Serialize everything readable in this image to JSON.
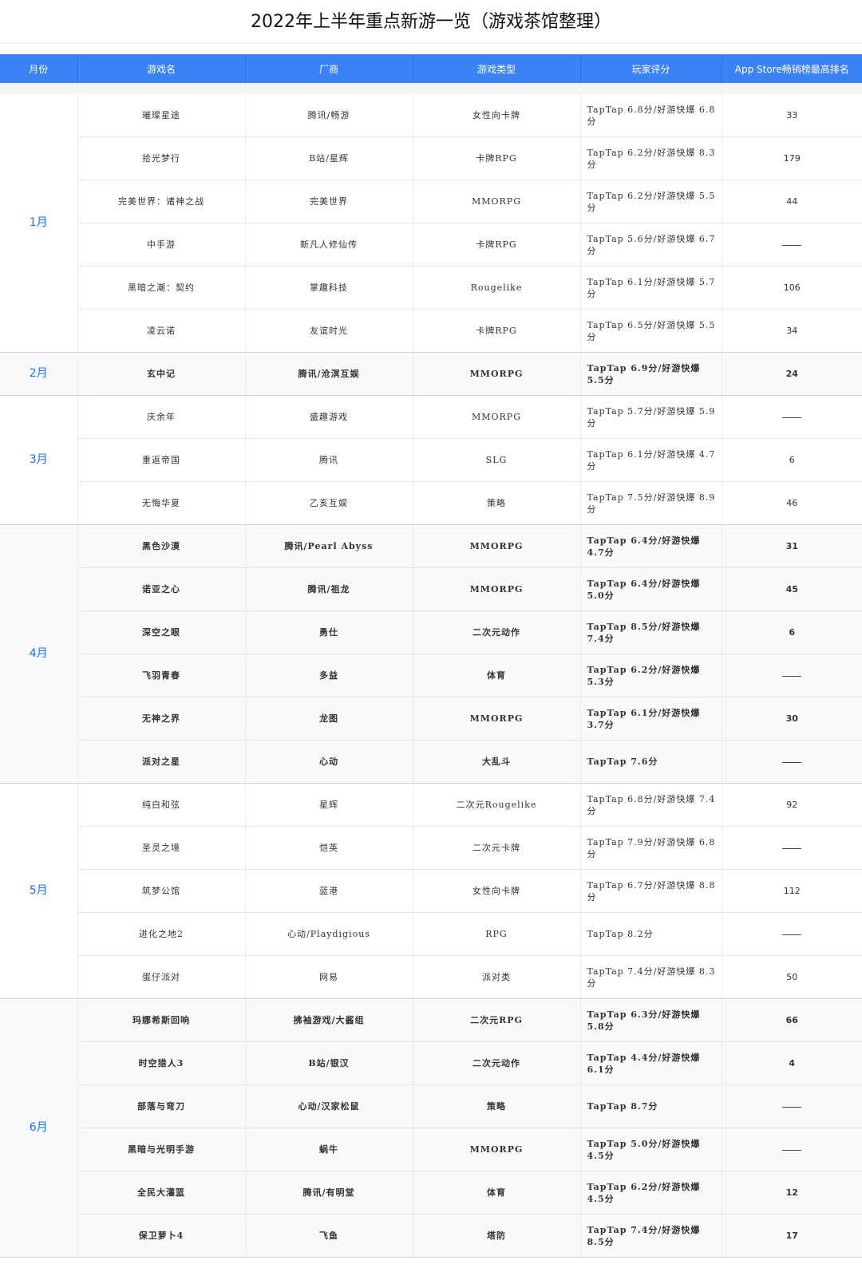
{
  "title": "2022年上半年重点新游一览（游戏茶馆整理）",
  "headers": [
    "月份",
    "游戏名",
    "厂商",
    "游戏类型",
    "玩家评分",
    "App Store畅销榜最高排名"
  ],
  "dash": "——",
  "groups": [
    {
      "month": "1月",
      "bold": false,
      "alt": false,
      "rows": [
        {
          "name": "璀璨星途",
          "vendor": "腾讯/畅游",
          "genre": "女性向卡牌",
          "score": "TapTap 6.8分/好游快爆 6.8分",
          "rank": "33"
        },
        {
          "name": "拾光梦行",
          "vendor": "B站/星辉",
          "genre": "卡牌RPG",
          "score": "TapTap 6.2分/好游快爆 8.3分",
          "rank": "179"
        },
        {
          "name": "完美世界：诸神之战",
          "vendor": "完美世界",
          "genre": "MMORPG",
          "score": "TapTap 6.2分/好游快爆 5.5分",
          "rank": "44"
        },
        {
          "name": "中手游",
          "vendor": "新凡人修仙传",
          "genre": "卡牌RPG",
          "score": "TapTap 5.6分/好游快爆 6.7分",
          "rank": ""
        },
        {
          "name": "黑暗之潮：契约",
          "vendor": "掌趣科技",
          "genre": "Rougelike",
          "score": "TapTap 6.1分/好游快爆 5.7分",
          "rank": "106"
        },
        {
          "name": "凌云诺",
          "vendor": "友谊时光",
          "genre": "卡牌RPG",
          "score": "TapTap 6.5分/好游快爆 5.5分",
          "rank": "34"
        }
      ]
    },
    {
      "month": "2月",
      "bold": true,
      "alt": true,
      "rows": [
        {
          "name": "玄中记",
          "vendor": "腾讯/沧溟互娱",
          "genre": "MMORPG",
          "score": "TapTap 6.9分/好游快爆 5.5分",
          "rank": "24"
        }
      ]
    },
    {
      "month": "3月",
      "bold": false,
      "alt": false,
      "rows": [
        {
          "name": "庆余年",
          "vendor": "盛趣游戏",
          "genre": "MMORPG",
          "score": "TapTap 5.7分/好游快爆 5.9分",
          "rank": ""
        },
        {
          "name": "重返帝国",
          "vendor": "腾讯",
          "genre": "SLG",
          "score": "TapTap 6.1分/好游快爆 4.7分",
          "rank": "6"
        },
        {
          "name": "无悔华夏",
          "vendor": "乙亥互娱",
          "genre": "策略",
          "score": "TapTap 7.5分/好游快爆 8.9分",
          "rank": "46"
        }
      ]
    },
    {
      "month": "4月",
      "bold": true,
      "alt": true,
      "rows": [
        {
          "name": "黑色沙漠",
          "vendor": "腾讯/Pearl Abyss",
          "genre": "MMORPG",
          "score": "TapTap 6.4分/好游快爆 4.7分",
          "rank": "31"
        },
        {
          "name": "诺亚之心",
          "vendor": "腾讯/祖龙",
          "genre": "MMORPG",
          "score": "TapTap 6.4分/好游快爆 5.0分",
          "rank": "45"
        },
        {
          "name": "深空之眼",
          "vendor": "勇仕",
          "genre": "二次元动作",
          "score": "TapTap 8.5分/好游快爆 7.4分",
          "rank": "6"
        },
        {
          "name": "飞羽青春",
          "vendor": "多益",
          "genre": "体育",
          "score": "TapTap 6.2分/好游快爆 5.3分",
          "rank": ""
        },
        {
          "name": "无神之界",
          "vendor": "龙图",
          "genre": "MMORPG",
          "score": "TapTap 6.1分/好游快爆 3.7分",
          "rank": "30"
        },
        {
          "name": "派对之星",
          "vendor": "心动",
          "genre": "大乱斗",
          "score": "TapTap 7.6分",
          "rank": ""
        }
      ]
    },
    {
      "month": "5月",
      "bold": false,
      "alt": false,
      "rows": [
        {
          "name": "纯白和弦",
          "vendor": "星辉",
          "genre": "二次元Rougelike",
          "score": "TapTap 6.8分/好游快爆 7.4分",
          "rank": "92"
        },
        {
          "name": "圣灵之境",
          "vendor": "恺英",
          "genre": "二次元卡牌",
          "score": "TapTap 7.9分/好游快爆 6.8分",
          "rank": ""
        },
        {
          "name": "筑梦公馆",
          "vendor": "蓝港",
          "genre": "女性向卡牌",
          "score": "TapTap 6.7分/好游快爆 8.8分",
          "rank": "112"
        },
        {
          "name": "进化之地2",
          "vendor": "心动/Playdigious",
          "genre": "RPG",
          "score": "TapTap 8.2分",
          "rank": ""
        },
        {
          "name": "蛋仔派对",
          "vendor": "网易",
          "genre": "派对类",
          "score": "TapTap 7.4分/好游快爆 8.3分",
          "rank": "50"
        }
      ]
    },
    {
      "month": "6月",
      "bold": true,
      "alt": true,
      "rows": [
        {
          "name": "玛娜希斯回响",
          "vendor": "拂袖游戏/大酱组",
          "genre": "二次元RPG",
          "score": "TapTap 6.3分/好游快爆 5.8分",
          "rank": "66"
        },
        {
          "name": "时空猎人3",
          "vendor": "B站/银汉",
          "genre": "二次元动作",
          "score": "TapTap 4.4分/好游快爆 6.1分",
          "rank": "4"
        },
        {
          "name": "部落与弯刀",
          "vendor": "心动/汉家松鼠",
          "genre": "策略",
          "score": "TapTap 8.7分",
          "rank": ""
        },
        {
          "name": "黑暗与光明手游",
          "vendor": "蜗牛",
          "genre": "MMORPG",
          "score": "TapTap 5.0分/好游快爆 4.5分",
          "rank": ""
        },
        {
          "name": "全民大灌篮",
          "vendor": "腾讯/有明堂",
          "genre": "体育",
          "score": "TapTap 6.2分/好游快爆 4.5分",
          "rank": "12"
        },
        {
          "name": "保卫萝卜4",
          "vendor": "飞鱼",
          "genre": "塔防",
          "score": "TapTap 7.4分/好游快爆 8.5分",
          "rank": "17"
        }
      ]
    }
  ]
}
